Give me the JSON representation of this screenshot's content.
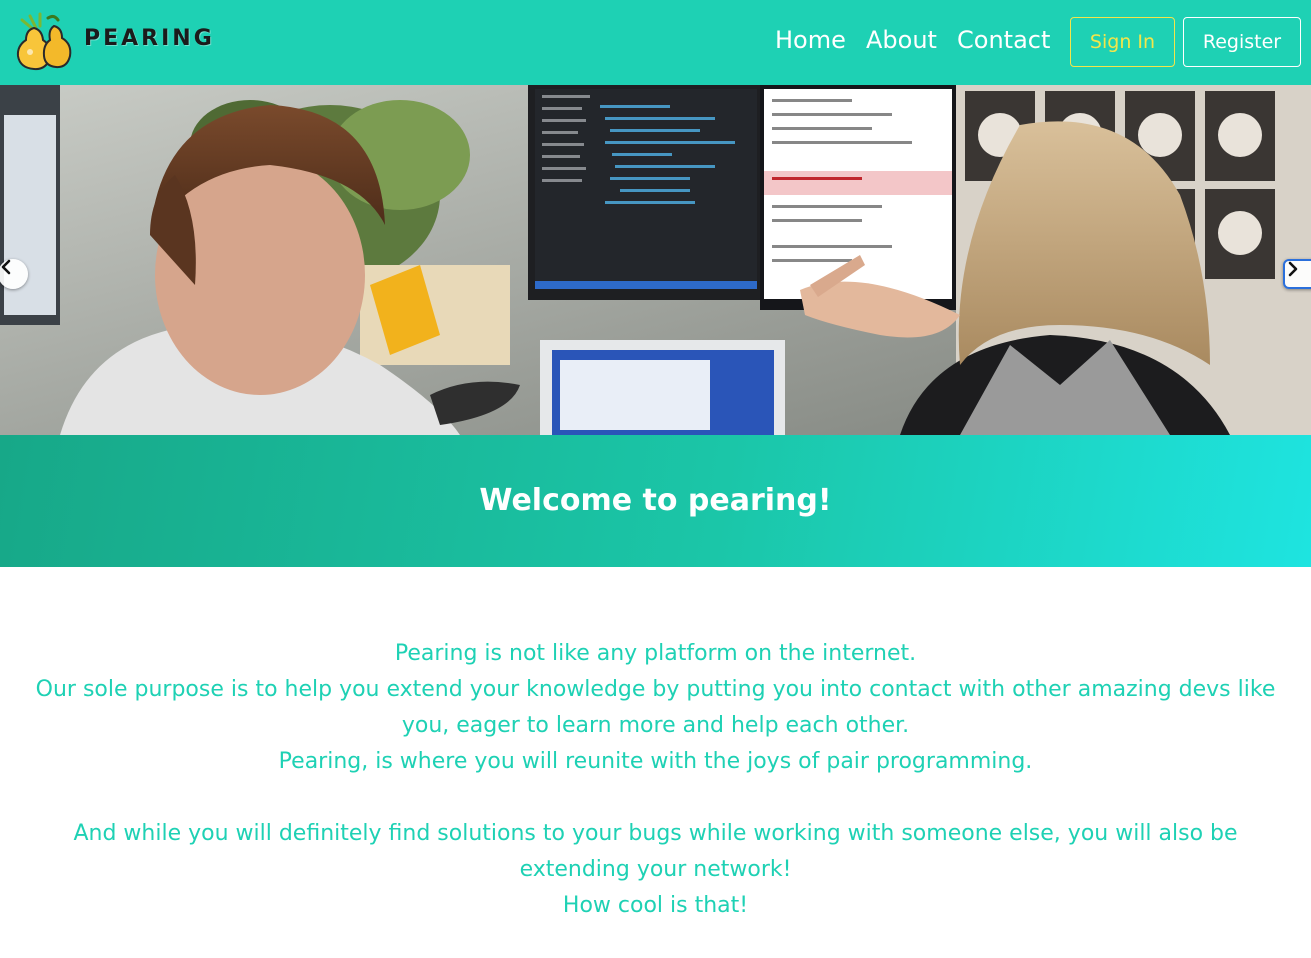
{
  "brand": {
    "name": "PEARING",
    "logo_icon": "pear-icon"
  },
  "nav": {
    "items": [
      {
        "label": "Home"
      },
      {
        "label": "About"
      },
      {
        "label": "Contact"
      }
    ],
    "sign_in_label": "Sign In",
    "register_label": "Register"
  },
  "carousel": {
    "prev_icon": "chevron-left-icon",
    "next_icon": "chevron-right-icon"
  },
  "welcome": {
    "title": "Welcome to pearing!"
  },
  "intro": {
    "line1": "Pearing is not like any platform on the internet.",
    "line2": "Our sole purpose is to help you extend your knowledge by putting you into contact with other amazing devs like you, eager to learn more and help each other.",
    "line3": "Pearing, is where you will reunite with the joys of pair programming.",
    "line4": "And while you will definitely find solutions to your bugs while working with someone else, you will also be extending your network!",
    "line5": "How cool is that!"
  },
  "colors": {
    "header_bg": "#1ed1b4",
    "accent_text": "#1ed1b4",
    "sign_in": "#f3e64a",
    "band_start": "#17a888",
    "band_end": "#1ee4e0"
  }
}
